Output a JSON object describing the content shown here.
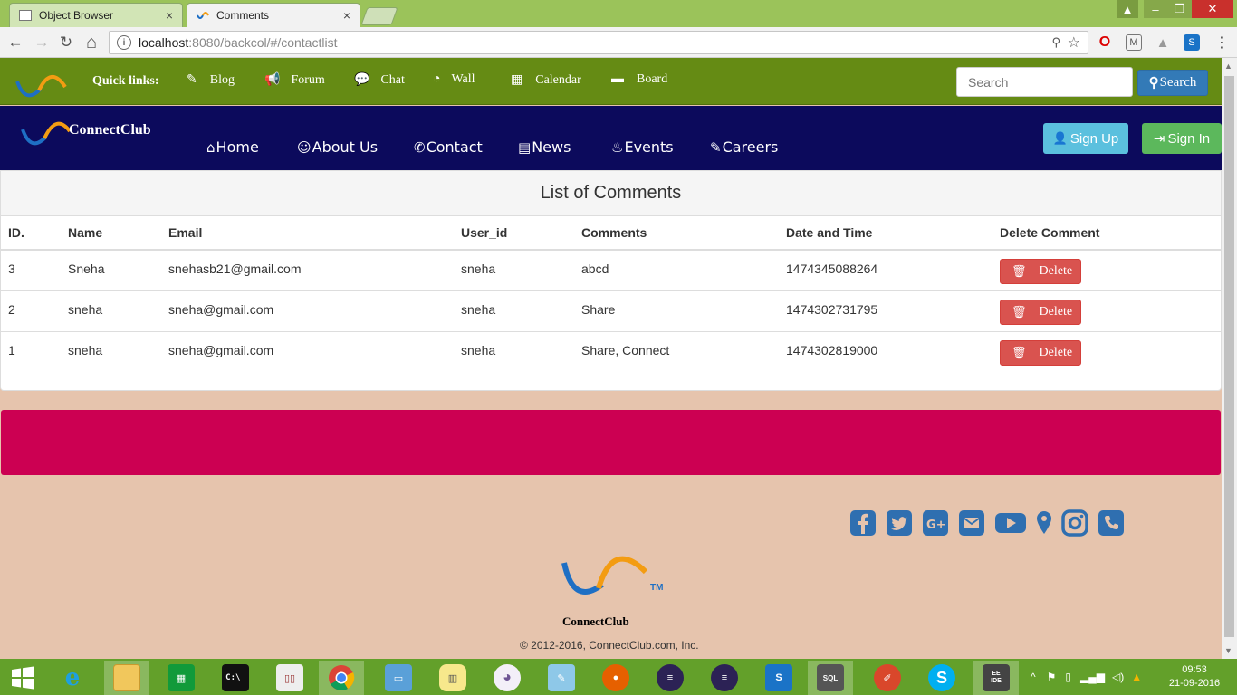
{
  "browser": {
    "tabs": [
      {
        "label": "Object Browser",
        "active": false
      },
      {
        "label": "Comments",
        "active": true
      }
    ],
    "close_glyph": "×",
    "url_host": "localhost",
    "url_path": ":8080/backcol/#/contactlist",
    "info_glyph": "i",
    "star_glyph": "☆",
    "key_glyph": "⚲",
    "back_glyph": "←",
    "forward_glyph": "→",
    "reload_glyph": "↻",
    "home_glyph": "⌂",
    "menu_glyph": "⋮",
    "min_glyph": "–",
    "max_glyph": "❐",
    "win_close_glyph": "✕",
    "user_glyph": "▲"
  },
  "quickbar": {
    "label": "Quick links:",
    "links": [
      {
        "label": "Blog",
        "icon": "✎"
      },
      {
        "label": "Forum",
        "icon": "📢"
      },
      {
        "label": "Chat",
        "icon": "💬"
      },
      {
        "label": "Wall",
        "icon": "◔"
      },
      {
        "label": "Calendar",
        "icon": "▦"
      },
      {
        "label": "Board",
        "icon": "▬"
      }
    ],
    "search_placeholder": "Search",
    "search_button": "Search",
    "search_glyph": "⚲"
  },
  "mainnav": {
    "brand": "ConnectClub",
    "links": [
      {
        "label": "Home",
        "icon": "⌂"
      },
      {
        "label": "About Us",
        "icon": "☺"
      },
      {
        "label": "Contact",
        "icon": "✆"
      },
      {
        "label": "News",
        "icon": "▤"
      },
      {
        "label": "Events",
        "icon": "♨"
      },
      {
        "label": "Careers",
        "icon": "✎"
      }
    ],
    "signup": "Sign Up",
    "signup_icon": "👤",
    "signin": "Sign In",
    "signin_icon": "⇥"
  },
  "comments": {
    "heading": "List of Comments",
    "columns": [
      "ID.",
      "Name",
      "Email",
      "User_id",
      "Comments",
      "Date and Time",
      "Delete Comment"
    ],
    "rows": [
      {
        "id": "3",
        "name": "Sneha",
        "email": "snehasb21@gmail.com",
        "user_id": "sneha",
        "comment": "abcd",
        "datetime": "1474345088264"
      },
      {
        "id": "2",
        "name": "sneha",
        "email": "sneha@gmail.com",
        "user_id": "sneha",
        "comment": "Share",
        "datetime": "1474302731795"
      },
      {
        "id": "1",
        "name": "sneha",
        "email": "sneha@gmail.com",
        "user_id": "sneha",
        "comment": "Share, Connect",
        "datetime": "1474302819000"
      }
    ],
    "delete_label": "Delete",
    "delete_icon": "🗑"
  },
  "footer": {
    "social": [
      "facebook-icon",
      "twitter-icon",
      "google-plus-icon",
      "email-icon",
      "youtube-icon",
      "location-icon",
      "instagram-icon",
      "phone-icon"
    ],
    "brand": "ConnectClub",
    "tm": "TM",
    "copyright": "© 2012-2016, ConnectClub.com, Inc."
  },
  "taskbar": {
    "apps": [
      "windows-start",
      "internet-explorer",
      "file-explorer",
      "windows-store",
      "command-prompt",
      "book-reader",
      "chrome",
      "remote-desktop",
      "database",
      "github",
      "notepad",
      "firefox",
      "eclipse",
      "eclipse",
      "xamarin",
      "sql-developer",
      "jmeter",
      "skype",
      "java-ee-ide"
    ],
    "time": "09:53",
    "date": "21-09-2016"
  },
  "colors": {
    "quickbar": "#658b14",
    "mainnav": "#0c0a5c",
    "pinkbar": "#cc0052",
    "page_bg": "#e6c4ad",
    "delete": "#d9534f",
    "signup": "#5bc0de",
    "signin": "#5cb85c",
    "search": "#337ab7"
  }
}
